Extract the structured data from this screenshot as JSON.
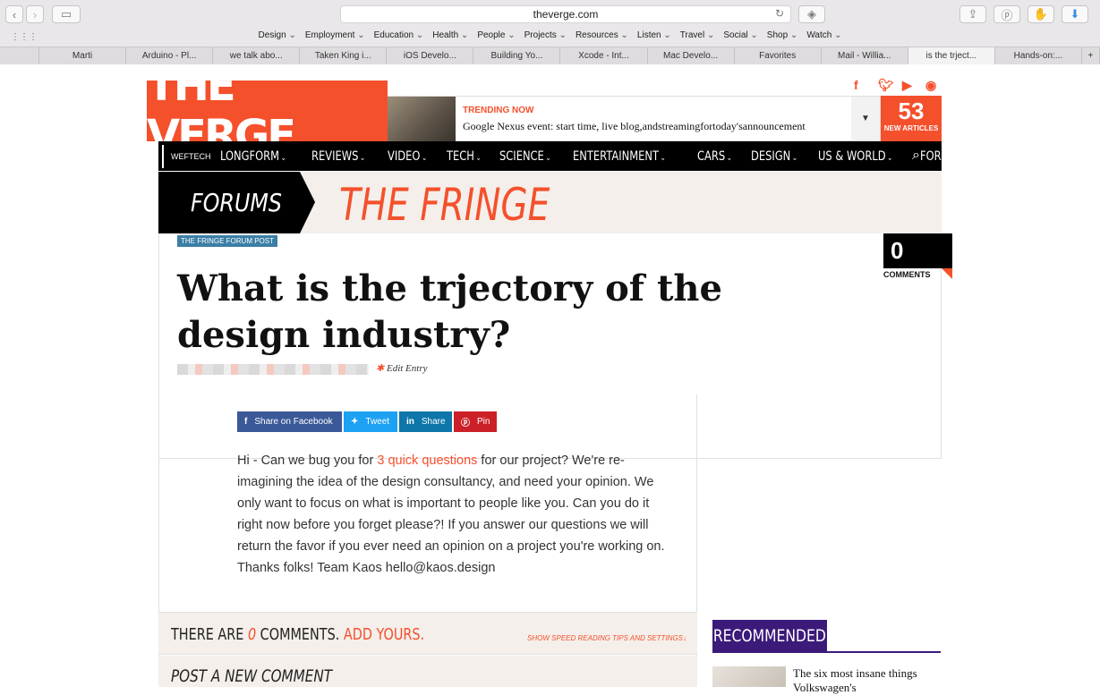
{
  "browser": {
    "url": "theverge.com",
    "favorites": [
      "Design",
      "Employment",
      "Education",
      "Health",
      "People",
      "Projects",
      "Resources",
      "Listen",
      "Travel",
      "Social",
      "Shop",
      "Watch"
    ],
    "tabs": [
      "Marti",
      "Arduino - Pl...",
      "we talk abo...",
      "Taken King i...",
      "iOS Develo...",
      "Building Yo...",
      "Xcode - Int...",
      "Mac Develo...",
      "Favorites",
      "Mail - Willia...",
      "is the trject...",
      "Hands-on:..."
    ]
  },
  "site": {
    "logo": "THE VERGE",
    "trending_label": "TRENDING NOW",
    "trending_text": "Google Nexus event: start time, live blog,andstreamingfortoday'sannouncement",
    "new_count": "53",
    "new_label": "NEW ARTICLES",
    "nav_user": "WEFTECH",
    "nav": [
      "LONGFORM",
      "REVIEWS",
      "VIDEO",
      "TECH",
      "SCIENCE",
      "ENTERTAINMENT",
      "CARS",
      "DESIGN",
      "US & WORLD",
      "FORUMS"
    ]
  },
  "forum": {
    "section": "FORUMS",
    "name": "THE FRINGE"
  },
  "article": {
    "tag": "THE FRINGE FORUM POST",
    "title": "What is the trjectory of the design industry?",
    "edit": "Edit Entry",
    "comment_count": "0",
    "comment_label": "COMMENTS",
    "share": {
      "facebook": "Share on Facebook",
      "twitter": "Tweet",
      "linkedin": "Share",
      "pinterest": "Pin"
    },
    "body_before": "Hi - Can we bug you for ",
    "body_link": "3 quick questions",
    "body_after": " for our project? We're re-imagining the idea of the design consultancy, and need your opinion. We only want to focus on what is important to people like you. Can you do it right now before you forget please?! If you answer our questions we will return the favor if you ever need an opinion on a project you're working on. Thanks folks! Team Kaos hello@kaos.design"
  },
  "comments": {
    "pre": "THERE ARE ",
    "count": "0",
    "mid": " COMMENTS. ",
    "add": "ADD YOURS.",
    "speed": "SHOW SPEED READING TIPS AND SETTINGS↓",
    "post": "POST A NEW COMMENT"
  },
  "recommended": {
    "label": "RECOMMENDED",
    "item": "The six most insane things Volkswagen's"
  },
  "colors": {
    "accent": "#f5502c",
    "purple": "#3c1a7a"
  }
}
